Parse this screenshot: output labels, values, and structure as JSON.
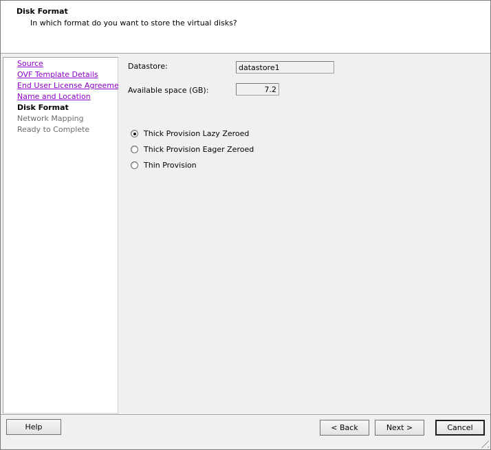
{
  "header": {
    "title": "Disk Format",
    "subtitle": "In which format do you want to store the virtual disks?"
  },
  "nav": {
    "items": [
      {
        "label": "Source",
        "state": "link"
      },
      {
        "label": "OVF Template Details",
        "state": "link"
      },
      {
        "label": "End User License Agreement",
        "state": "link"
      },
      {
        "label": "Name and Location",
        "state": "link"
      },
      {
        "label": "Disk Format",
        "state": "current"
      },
      {
        "label": "Network Mapping",
        "state": "disabled"
      },
      {
        "label": "Ready to Complete",
        "state": "disabled"
      }
    ]
  },
  "form": {
    "datastore_label": "Datastore:",
    "datastore_value": "datastore1",
    "space_label": "Available space (GB):",
    "space_value": "7.2",
    "options": [
      {
        "label": "Thick Provision Lazy Zeroed",
        "selected": true
      },
      {
        "label": "Thick Provision Eager Zeroed",
        "selected": false
      },
      {
        "label": "Thin Provision",
        "selected": false
      }
    ]
  },
  "buttons": {
    "help": "Help",
    "back": "< Back",
    "next": "Next >",
    "cancel": "Cancel"
  },
  "colors": {
    "link": "#8b00c8",
    "disabled": "#6d6d6d"
  }
}
